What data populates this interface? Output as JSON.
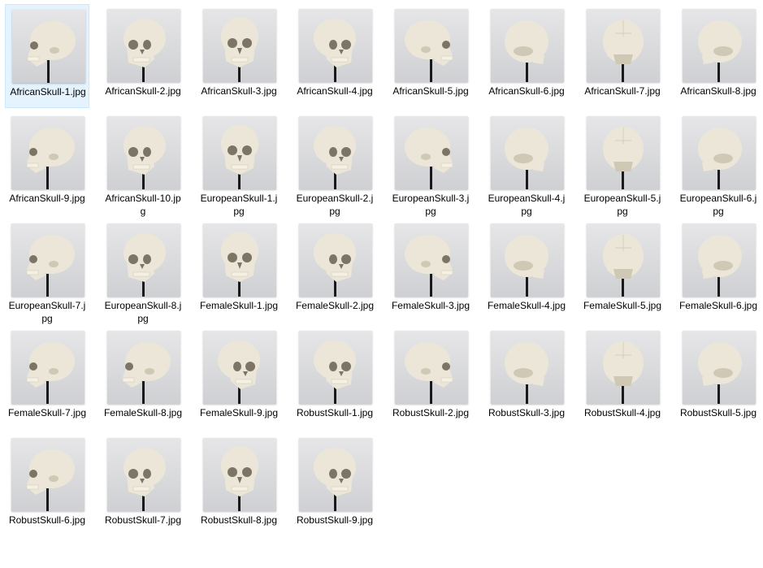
{
  "window": {
    "view": "Large icons"
  },
  "colors": {
    "background": "#ffffff",
    "selection_fill": "#e5f3ff",
    "selection_border": "#cce8ff",
    "label_text": "#000000"
  },
  "files": [
    {
      "name": "AfricanSkull-1.jpg",
      "selected": true,
      "view": "left-profile",
      "icon": "skull-thumbnail-icon"
    },
    {
      "name": "AfricanSkull-2.jpg",
      "selected": false,
      "view": "left-three-quarter",
      "icon": "skull-thumbnail-icon"
    },
    {
      "name": "AfricanSkull-3.jpg",
      "selected": false,
      "view": "front",
      "icon": "skull-thumbnail-icon"
    },
    {
      "name": "AfricanSkull-4.jpg",
      "selected": false,
      "view": "right-three-quarter",
      "icon": "skull-thumbnail-icon"
    },
    {
      "name": "AfricanSkull-5.jpg",
      "selected": false,
      "view": "right-profile",
      "icon": "skull-thumbnail-icon"
    },
    {
      "name": "AfricanSkull-6.jpg",
      "selected": false,
      "view": "back-right",
      "icon": "skull-thumbnail-icon"
    },
    {
      "name": "AfricanSkull-7.jpg",
      "selected": false,
      "view": "back",
      "icon": "skull-thumbnail-icon"
    },
    {
      "name": "AfricanSkull-8.jpg",
      "selected": false,
      "view": "back-left",
      "icon": "skull-thumbnail-icon"
    },
    {
      "name": "AfricanSkull-9.jpg",
      "selected": false,
      "view": "left-profile",
      "icon": "skull-thumbnail-icon"
    },
    {
      "name": "AfricanSkull-10.jpg",
      "selected": false,
      "view": "left-three-quarter",
      "icon": "skull-thumbnail-icon"
    },
    {
      "name": "EuropeanSkull-1.jpg",
      "selected": false,
      "view": "front",
      "icon": "skull-thumbnail-icon"
    },
    {
      "name": "EuropeanSkull-2.jpg",
      "selected": false,
      "view": "right-three-quarter",
      "icon": "skull-thumbnail-icon"
    },
    {
      "name": "EuropeanSkull-3.jpg",
      "selected": false,
      "view": "right-profile",
      "icon": "skull-thumbnail-icon"
    },
    {
      "name": "EuropeanSkull-4.jpg",
      "selected": false,
      "view": "back-right",
      "icon": "skull-thumbnail-icon"
    },
    {
      "name": "EuropeanSkull-5.jpg",
      "selected": false,
      "view": "back",
      "icon": "skull-thumbnail-icon"
    },
    {
      "name": "EuropeanSkull-6.jpg",
      "selected": false,
      "view": "back-left",
      "icon": "skull-thumbnail-icon"
    },
    {
      "name": "EuropeanSkull-7.jpg",
      "selected": false,
      "view": "left-profile",
      "icon": "skull-thumbnail-icon"
    },
    {
      "name": "EuropeanSkull-8.jpg",
      "selected": false,
      "view": "left-three-quarter",
      "icon": "skull-thumbnail-icon"
    },
    {
      "name": "FemaleSkull-1.jpg",
      "selected": false,
      "view": "front",
      "icon": "skull-thumbnail-icon"
    },
    {
      "name": "FemaleSkull-2.jpg",
      "selected": false,
      "view": "right-three-quarter",
      "icon": "skull-thumbnail-icon"
    },
    {
      "name": "FemaleSkull-3.jpg",
      "selected": false,
      "view": "right-profile",
      "icon": "skull-thumbnail-icon"
    },
    {
      "name": "FemaleSkull-4.jpg",
      "selected": false,
      "view": "back-right",
      "icon": "skull-thumbnail-icon"
    },
    {
      "name": "FemaleSkull-5.jpg",
      "selected": false,
      "view": "back",
      "icon": "skull-thumbnail-icon"
    },
    {
      "name": "FemaleSkull-6.jpg",
      "selected": false,
      "view": "back-left",
      "icon": "skull-thumbnail-icon"
    },
    {
      "name": "FemaleSkull-7.jpg",
      "selected": false,
      "view": "left-profile",
      "icon": "skull-thumbnail-icon"
    },
    {
      "name": "FemaleSkull-8.jpg",
      "selected": false,
      "view": "left-profile",
      "icon": "skull-thumbnail-icon"
    },
    {
      "name": "FemaleSkull-9.jpg",
      "selected": false,
      "view": "right-three-quarter",
      "icon": "skull-thumbnail-icon"
    },
    {
      "name": "RobustSkull-1.jpg",
      "selected": false,
      "view": "right-three-quarter",
      "icon": "skull-thumbnail-icon"
    },
    {
      "name": "RobustSkull-2.jpg",
      "selected": false,
      "view": "right-profile",
      "icon": "skull-thumbnail-icon"
    },
    {
      "name": "RobustSkull-3.jpg",
      "selected": false,
      "view": "back-right",
      "icon": "skull-thumbnail-icon"
    },
    {
      "name": "RobustSkull-4.jpg",
      "selected": false,
      "view": "back",
      "icon": "skull-thumbnail-icon"
    },
    {
      "name": "RobustSkull-5.jpg",
      "selected": false,
      "view": "back-left",
      "icon": "skull-thumbnail-icon"
    },
    {
      "name": "RobustSkull-6.jpg",
      "selected": false,
      "view": "left-profile",
      "icon": "skull-thumbnail-icon"
    },
    {
      "name": "RobustSkull-7.jpg",
      "selected": false,
      "view": "left-three-quarter",
      "icon": "skull-thumbnail-icon"
    },
    {
      "name": "RobustSkull-8.jpg",
      "selected": false,
      "view": "front",
      "icon": "skull-thumbnail-icon"
    },
    {
      "name": "RobustSkull-9.jpg",
      "selected": false,
      "view": "right-three-quarter",
      "icon": "skull-thumbnail-icon"
    }
  ]
}
